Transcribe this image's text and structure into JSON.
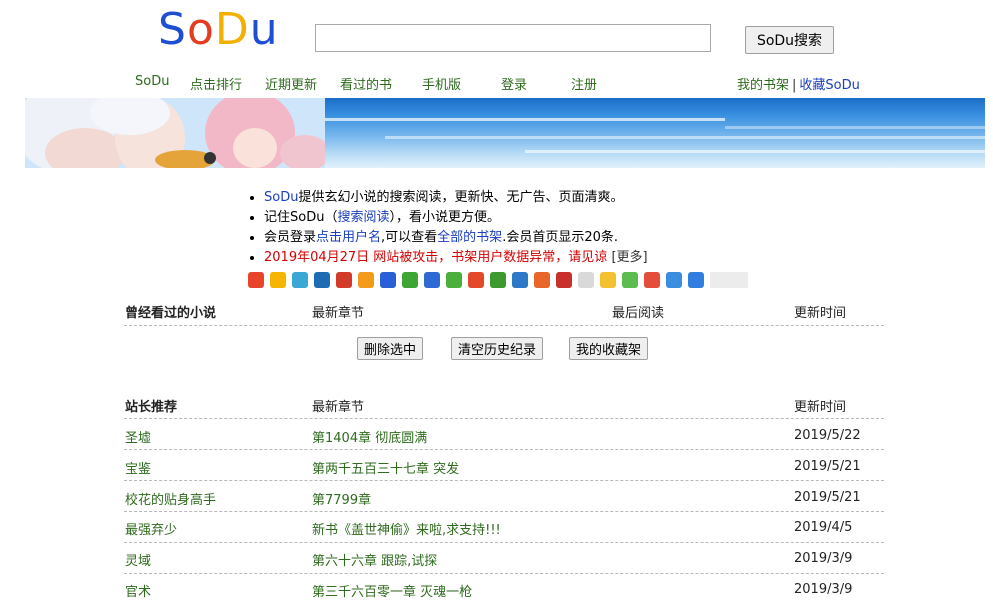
{
  "logo": {
    "letters": [
      "S",
      "o",
      "D",
      "u"
    ],
    "colors": [
      "#1f4fd1",
      "#e23d1f",
      "#f2b100",
      "#1f4fd1"
    ]
  },
  "search": {
    "value": "",
    "placeholder": "",
    "button_label": "SoDu搜索"
  },
  "nav": {
    "items": [
      "SoDu",
      "点击排行",
      "近期更新",
      "看过的书",
      "手机版",
      "登录",
      "注册"
    ],
    "right_bookshelf": "我的书架",
    "right_separator": "|",
    "right_favorite": "收藏SoDu"
  },
  "info": {
    "line1_brand": "SoDu",
    "line1_rest": "提供玄幻小说的搜索阅读，更新快、无广告、页面清爽。",
    "line2_a": "记住SoDu（",
    "line2_link": "搜索阅读",
    "line2_b": "），看小说更方便。",
    "line3_a": "会员登录",
    "line3_link1": "点击用户名",
    "line3_b": ",可以查看",
    "line3_link2": "全部的书架",
    "line3_c": ".会员首页显示20条.",
    "line4_notice": "2019年04月27日 网站被攻击，书架用户数据异常，请见谅",
    "line4_more": "[更多]"
  },
  "share_icons": [
    "weibo-icon",
    "qzone-icon",
    "tencent-weibo-icon",
    "renren-icon",
    "kaixin-icon",
    "douban-share-icon",
    "baidu-icon",
    "qq-icon",
    "paw-icon",
    "clover-icon",
    "t-icon",
    "douban-icon",
    "tieba-icon",
    "sohu-icon",
    "netease-icon",
    "bookmark-icon",
    "qq-friends-icon",
    "chat-icon",
    "recycle-icon",
    "info-icon",
    "plus-icon"
  ],
  "history": {
    "headers": {
      "name": "曾经看过的小说",
      "chapter": "最新章节",
      "last_read": "最后阅读",
      "updated": "更新时间"
    },
    "buttons": {
      "delete": "删除选中",
      "clear": "清空历史纪录",
      "favorites": "我的收藏架"
    }
  },
  "recommend": {
    "headers": {
      "name": "站长推荐",
      "chapter": "最新章节",
      "updated": "更新时间"
    },
    "rows": [
      {
        "name": "圣墟",
        "chapter": "第1404章 彻底圆满",
        "date": "2019/5/22"
      },
      {
        "name": "宝鉴",
        "chapter": "第两千五百三十七章 突发",
        "date": "2019/5/21"
      },
      {
        "name": "校花的贴身高手",
        "chapter": "第7799章",
        "date": "2019/5/21"
      },
      {
        "name": "最强弃少",
        "chapter": "新书《盖世神偷》来啦,求支持!!!",
        "date": "2019/4/5"
      },
      {
        "name": "灵域",
        "chapter": "第六十六章 跟踪,试探",
        "date": "2019/3/9"
      },
      {
        "name": "官术",
        "chapter": "第三千六百零一章 灭魂一枪",
        "date": "2019/3/9"
      }
    ]
  },
  "colors": {
    "link_green": "#2e6b1e",
    "link_blue": "#1a3fbf",
    "notice_red": "#d40000",
    "banner_blue": "#3a90e0"
  }
}
